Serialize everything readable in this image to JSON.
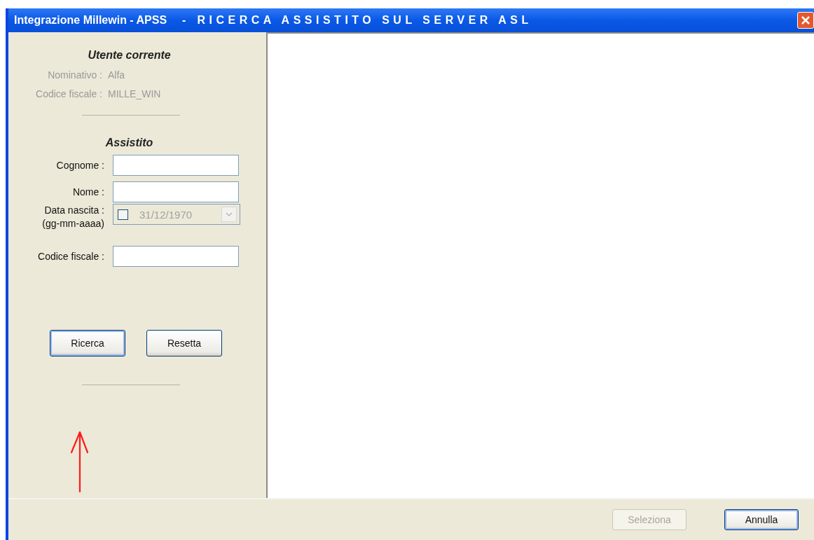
{
  "window": {
    "title_app": "Integrazione Millewin - APSS",
    "title_separator": "-",
    "title_section": "RICERCA ASSISTITO SUL SERVER ASL"
  },
  "current_user": {
    "heading": "Utente corrente",
    "fields": [
      {
        "label": "Nominativo :",
        "value": "Alfa"
      },
      {
        "label": "Codice fiscale :",
        "value": "MILLE_WIN"
      }
    ]
  },
  "patient": {
    "heading": "Assistito",
    "fields": [
      {
        "kind": "text",
        "label": "Cognome :"
      },
      {
        "kind": "text",
        "label": "Nome :"
      },
      {
        "kind": "date",
        "label": "Data nascita :",
        "hint": "(gg-mm-aaaa)",
        "value": "31/12/1970",
        "checked": false,
        "disabled": true
      },
      {
        "kind": "text",
        "label": "Codice fiscale :"
      }
    ]
  },
  "actions": [
    {
      "label": "Ricerca",
      "default": true,
      "disabled": false
    },
    {
      "label": "Resetta",
      "default": false,
      "disabled": false
    }
  ],
  "footer_buttons": [
    {
      "label": "Seleziona",
      "default": false,
      "disabled": true
    },
    {
      "label": "Annulla",
      "default": true,
      "disabled": false
    }
  ]
}
